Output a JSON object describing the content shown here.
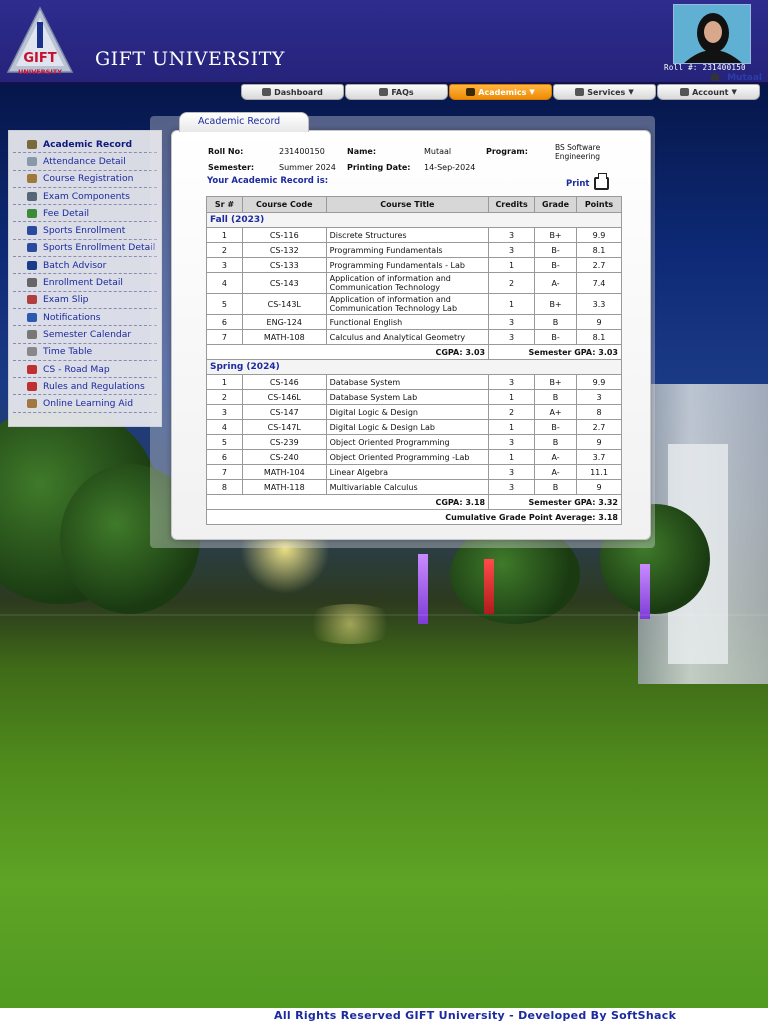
{
  "header": {
    "logo_text": "GIFT",
    "logo_sub": "UNIVERSITY",
    "university_name": "GIFT UNIVERSITY",
    "roll_line": "Roll #: 231400150",
    "user_name": "Mutaal"
  },
  "nav": [
    {
      "label": "Dashboard",
      "icon": "home-icon",
      "dropdown": false,
      "active": false
    },
    {
      "label": "FAQs",
      "icon": "faq-icon",
      "dropdown": false,
      "active": false
    },
    {
      "label": "Academics",
      "icon": "graduation-cap-icon",
      "dropdown": true,
      "active": true
    },
    {
      "label": "Services",
      "icon": "gears-icon",
      "dropdown": true,
      "active": false
    },
    {
      "label": "Account",
      "icon": "users-icon",
      "dropdown": true,
      "active": false
    }
  ],
  "sidebar": [
    {
      "label": "Academic Record",
      "color": "#7a6a3a",
      "active": true
    },
    {
      "label": "Attendance Detail",
      "color": "#8899aa"
    },
    {
      "label": "Course Registration",
      "color": "#a0783c"
    },
    {
      "label": "Exam Components",
      "color": "#556677"
    },
    {
      "label": "Fee Detail",
      "color": "#3a8a3a"
    },
    {
      "label": "Sports Enrollment",
      "color": "#2a4aa0"
    },
    {
      "label": "Sports Enrollment Detail",
      "color": "#2a4aa0"
    },
    {
      "label": "Batch Advisor",
      "color": "#1a3a8a"
    },
    {
      "label": "Enrollment Detail",
      "color": "#666666"
    },
    {
      "label": "Exam Slip",
      "color": "#b04040"
    },
    {
      "label": "Notifications",
      "color": "#2a5ab0"
    },
    {
      "label": "Semester Calendar",
      "color": "#777777"
    },
    {
      "label": "Time Table",
      "color": "#888888"
    },
    {
      "label": "CS - Road Map",
      "color": "#c03030"
    },
    {
      "label": "Rules and Regulations",
      "color": "#c03030"
    },
    {
      "label": "Online Learning Aid",
      "color": "#a07840"
    }
  ],
  "panel": {
    "tab_label": "Academic Record",
    "roll_label": "Roll No:",
    "roll_value": "231400150",
    "name_label": "Name:",
    "name_value": "Mutaal",
    "program_label": "Program:",
    "program_value_1": "BS Software",
    "program_value_2": "Engineering",
    "semester_label": "Semester:",
    "semester_value": "Summer 2024",
    "printing_label": "Printing Date:",
    "printing_value": "14-Sep-2024",
    "record_label": "Your Academic Record is:",
    "print_label": "Print"
  },
  "table": {
    "headers": [
      "Sr #",
      "Course Code",
      "Course Title",
      "Credits",
      "Grade",
      "Points"
    ],
    "semesters": [
      {
        "name": "Fall (2023)",
        "rows": [
          [
            "1",
            "CS-116",
            "Discrete Structures",
            "3",
            "B+",
            "9.9"
          ],
          [
            "2",
            "CS-132",
            "Programming Fundamentals",
            "3",
            "B-",
            "8.1"
          ],
          [
            "3",
            "CS-133",
            "Programming Fundamentals - Lab",
            "1",
            "B-",
            "2.7"
          ],
          [
            "4",
            "CS-143",
            "Application of information and Communication Technology",
            "2",
            "A-",
            "7.4"
          ],
          [
            "5",
            "CS-143L",
            "Application of information and Communication Technology Lab",
            "1",
            "B+",
            "3.3"
          ],
          [
            "6",
            "ENG-124",
            "Functional English",
            "3",
            "B",
            "9"
          ],
          [
            "7",
            "MATH-108",
            "Calculus and Analytical Geometry",
            "3",
            "B-",
            "8.1"
          ]
        ],
        "cgpa": "CGPA: 3.03",
        "sgpa": "Semester GPA: 3.03"
      },
      {
        "name": "Spring (2024)",
        "rows": [
          [
            "1",
            "CS-146",
            "Database System",
            "3",
            "B+",
            "9.9"
          ],
          [
            "2",
            "CS-146L",
            "Database System Lab",
            "1",
            "B",
            "3"
          ],
          [
            "3",
            "CS-147",
            "Digital Logic & Design",
            "2",
            "A+",
            "8"
          ],
          [
            "4",
            "CS-147L",
            "Digital Logic & Design Lab",
            "1",
            "B-",
            "2.7"
          ],
          [
            "5",
            "CS-239",
            "Object Oriented Programming",
            "3",
            "B",
            "9"
          ],
          [
            "6",
            "CS-240",
            "Object Oriented Programming -Lab",
            "1",
            "A-",
            "3.7"
          ],
          [
            "7",
            "MATH-104",
            "Linear Algebra",
            "3",
            "A-",
            "11.1"
          ],
          [
            "8",
            "MATH-118",
            "Multivariable Calculus",
            "3",
            "B",
            "9"
          ]
        ],
        "cgpa": "CGPA: 3.18",
        "sgpa": "Semester GPA: 3.32"
      }
    ],
    "cumulative": "Cumulative Grade Point Average: 3.18"
  },
  "footer": {
    "text": "All Rights Reserved GIFT University - Developed By SoftShack"
  }
}
